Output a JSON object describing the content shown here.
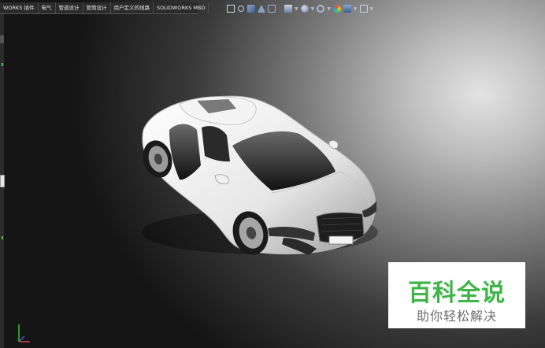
{
  "tabs": [
    "WORKS 插件",
    "电气",
    "管道设计",
    "管筒设计",
    "用户定义的线路",
    "SOLIDWORKS MBD"
  ],
  "hud_icons": [
    "zoom-fit-icon",
    "zoom-area-icon",
    "previous-view-icon",
    "section-view-icon",
    "dynamic-annotation-icon",
    "view-orientation-icon",
    "display-style-icon",
    "hide-show-items-icon",
    "edit-appearance-icon",
    "apply-scene-icon",
    "view-settings-icon"
  ],
  "watermark": {
    "title": "百科全说",
    "subtitle": "助你轻松解决"
  },
  "colors": {
    "watermark_green": "#3fb548",
    "background_light": "#e3e3e3",
    "background_dark": "#151515"
  }
}
